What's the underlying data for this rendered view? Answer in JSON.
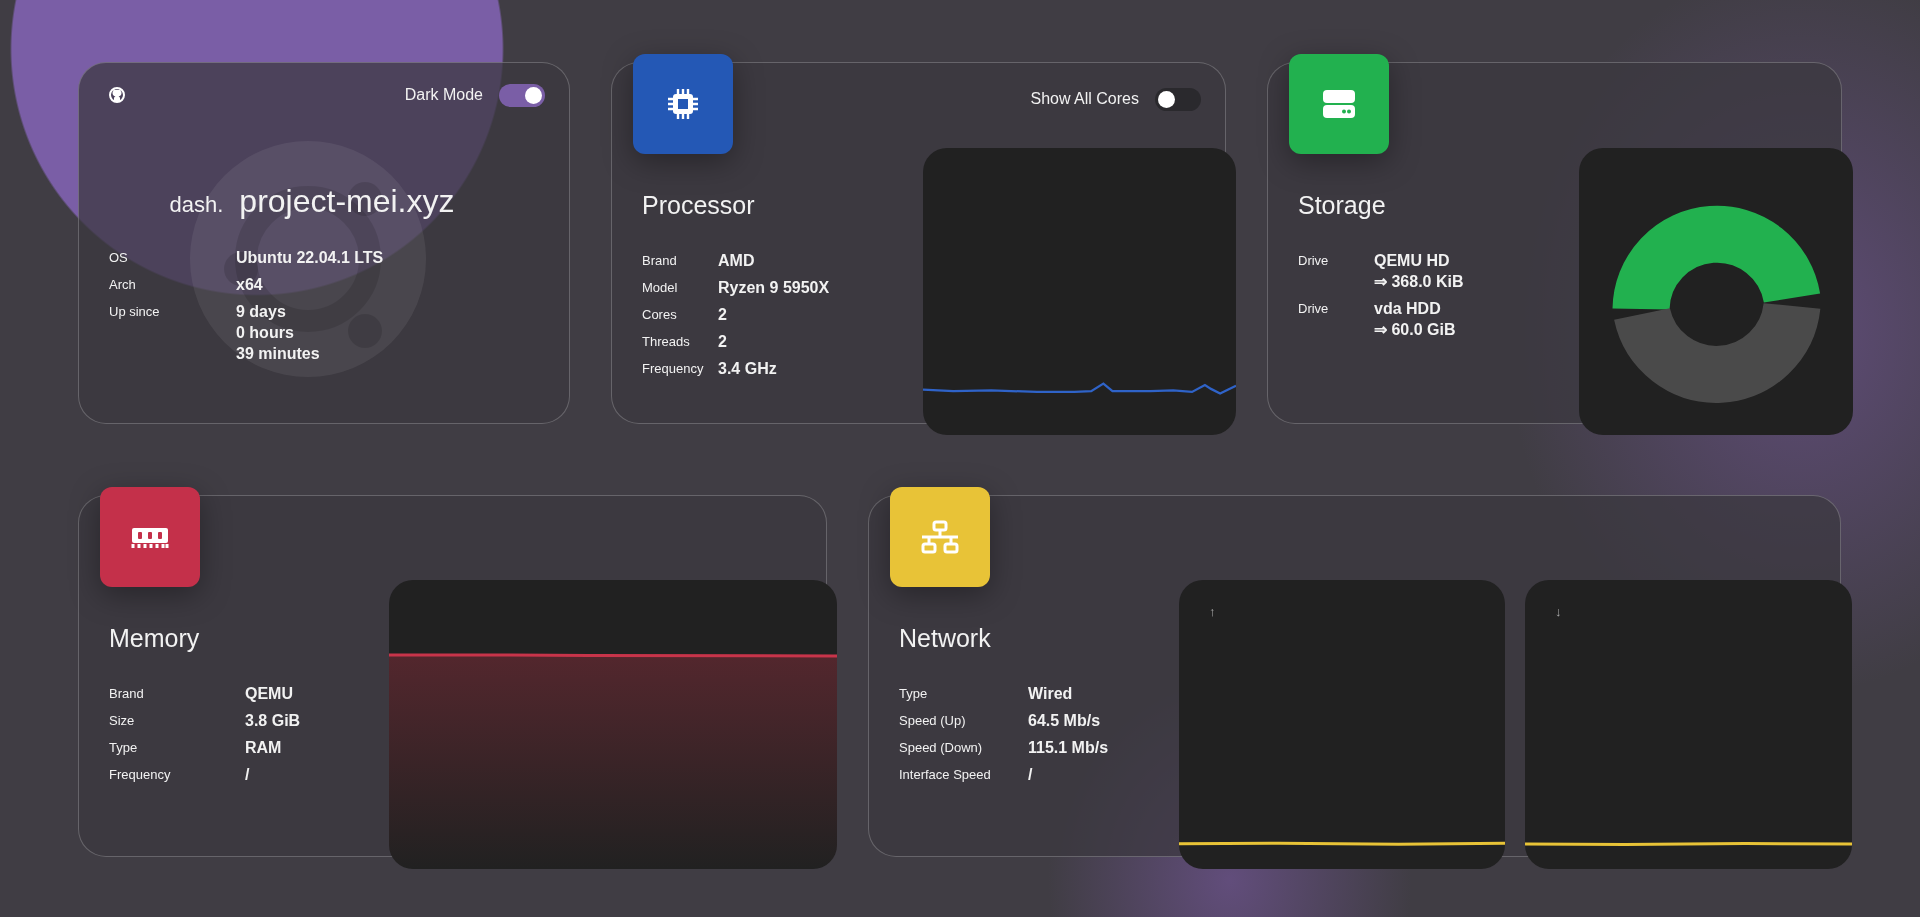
{
  "header": {
    "dark_mode": {
      "label": "Dark Mode",
      "on": true
    },
    "brand_prefix": "dash.",
    "brand_name": "project-mei.xyz",
    "info": [
      {
        "label": "OS",
        "values": [
          "Ubuntu 22.04.1 LTS"
        ]
      },
      {
        "label": "Arch",
        "values": [
          "x64"
        ]
      },
      {
        "label": "Up since",
        "values": [
          "9 days",
          "0 hours",
          "39 minutes"
        ]
      }
    ]
  },
  "processor": {
    "title": "Processor",
    "show_all_cores": {
      "label": "Show All Cores",
      "on": false
    },
    "info": [
      {
        "label": "Brand",
        "values": [
          "AMD"
        ]
      },
      {
        "label": "Model",
        "values": [
          "Ryzen 9 5950X"
        ]
      },
      {
        "label": "Cores",
        "values": [
          "2"
        ]
      },
      {
        "label": "Threads",
        "values": [
          "2"
        ]
      },
      {
        "label": "Frequency",
        "values": [
          "3.4 GHz"
        ]
      }
    ]
  },
  "storage": {
    "title": "Storage",
    "info": [
      {
        "label": "Drive",
        "values": [
          "QEMU HD",
          "⇒ 368.0 KiB"
        ]
      },
      {
        "label": "Drive",
        "values": [
          "vda HDD",
          "⇒ 60.0 GiB"
        ]
      }
    ]
  },
  "memory": {
    "title": "Memory",
    "info": [
      {
        "label": "Brand",
        "values": [
          "QEMU"
        ]
      },
      {
        "label": "Size",
        "values": [
          "3.8 GiB"
        ]
      },
      {
        "label": "Type",
        "values": [
          "RAM"
        ]
      },
      {
        "label": "Frequency",
        "values": [
          "/"
        ]
      }
    ]
  },
  "network": {
    "title": "Network",
    "info": [
      {
        "label": "Type",
        "values": [
          "Wired"
        ]
      },
      {
        "label": "Speed (Up)",
        "values": [
          "64.5 Mb/s"
        ]
      },
      {
        "label": "Speed (Down)",
        "values": [
          "115.1 Mb/s"
        ]
      },
      {
        "label": "Interface Speed",
        "values": [
          "/"
        ]
      }
    ],
    "graphs": [
      {
        "arrow": "↑"
      },
      {
        "arrow": "↓"
      }
    ]
  }
}
